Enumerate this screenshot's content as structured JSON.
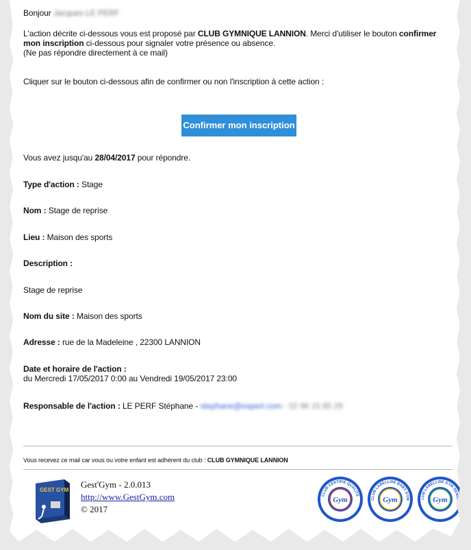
{
  "greeting": {
    "prefix": "Bonjour",
    "name": "Jacques LE PERF"
  },
  "intro": {
    "line1_a": "L'action décrite ci-dessous vous est proposé par ",
    "line1_club": "CLUB GYMNIQUE LANNION",
    "line1_b": ". Merci d'utiliser le bouton ",
    "line1_confirm": "confirmer",
    "line2_bold": "mon inscription",
    "line2_rest": " ci-dessous pour signaler votre présence ou absence.",
    "line3": "(Ne pas répondre directement à ce mail)"
  },
  "instruction": "Cliquer sur le bouton ci-dessous afin de confirmer ou non l'inscription à cette action :",
  "confirm_button": "Confirmer mon inscription",
  "deadline": {
    "prefix": "Vous avez jusqu'au ",
    "date": "28/04/2017",
    "suffix": " pour répondre."
  },
  "fields": {
    "type_label": "Type d'action :",
    "type_value": " Stage",
    "nom_label": "Nom :",
    "nom_value": " Stage de reprise",
    "lieu_label": "Lieu :",
    "lieu_value": " Maison des sports",
    "description_label": "Description :",
    "description_value": "Stage de reprise",
    "site_label": "Nom du site :",
    "site_value": " Maison des sports",
    "adresse_label": "Adresse :",
    "adresse_value": " rue de la Madeleine , 22300 LANNION",
    "date_label": "Date et horaire de l'action :",
    "date_value": "du Mercredi 17/05/2017 0:00 au Vendredi 19/05/2017 23:00",
    "responsable_label": "Responsable de l'action :",
    "responsable_value": " LE PERF Stéphane",
    "responsable_sep": " - ",
    "responsable_email": "stephane@expert.com",
    "responsable_phone": " - 02 96 15 85 29"
  },
  "footer": {
    "notice_prefix": "Vous recevez ce mail car vous ou votre enfant est adhérent du club : ",
    "notice_club": "CLUB GYMNIQUE LANNION",
    "product": "Gest'Gym - 2.0.013",
    "url": "http://www.GestGym.com",
    "copyright": "© 2017",
    "logo_text": "GEST GYM"
  },
  "badges": [
    {
      "top": "CLUB CERTIFIÉ QUALITÉ",
      "center": "Gym",
      "bottom": "WWW.FFGYM.FR",
      "color": "#1e56c8",
      "ring": "#e33b3b"
    },
    {
      "top": "CLUB LABELLISÉ BABY GYM",
      "center": "Gym",
      "bottom": "WWW.FFGYM.FR",
      "color": "#1e56c8",
      "ring": "#f2b700"
    },
    {
      "top": "CLUB LABELLISÉ GYM SENIOR",
      "center": "Gym",
      "bottom": "WWW.FFGYM.FR",
      "color": "#1e56c8",
      "ring": "#39a845"
    }
  ],
  "colors": {
    "button": "#2f8fd8",
    "link": "#1a1aa8",
    "accent_badge": "#1e56c8"
  }
}
